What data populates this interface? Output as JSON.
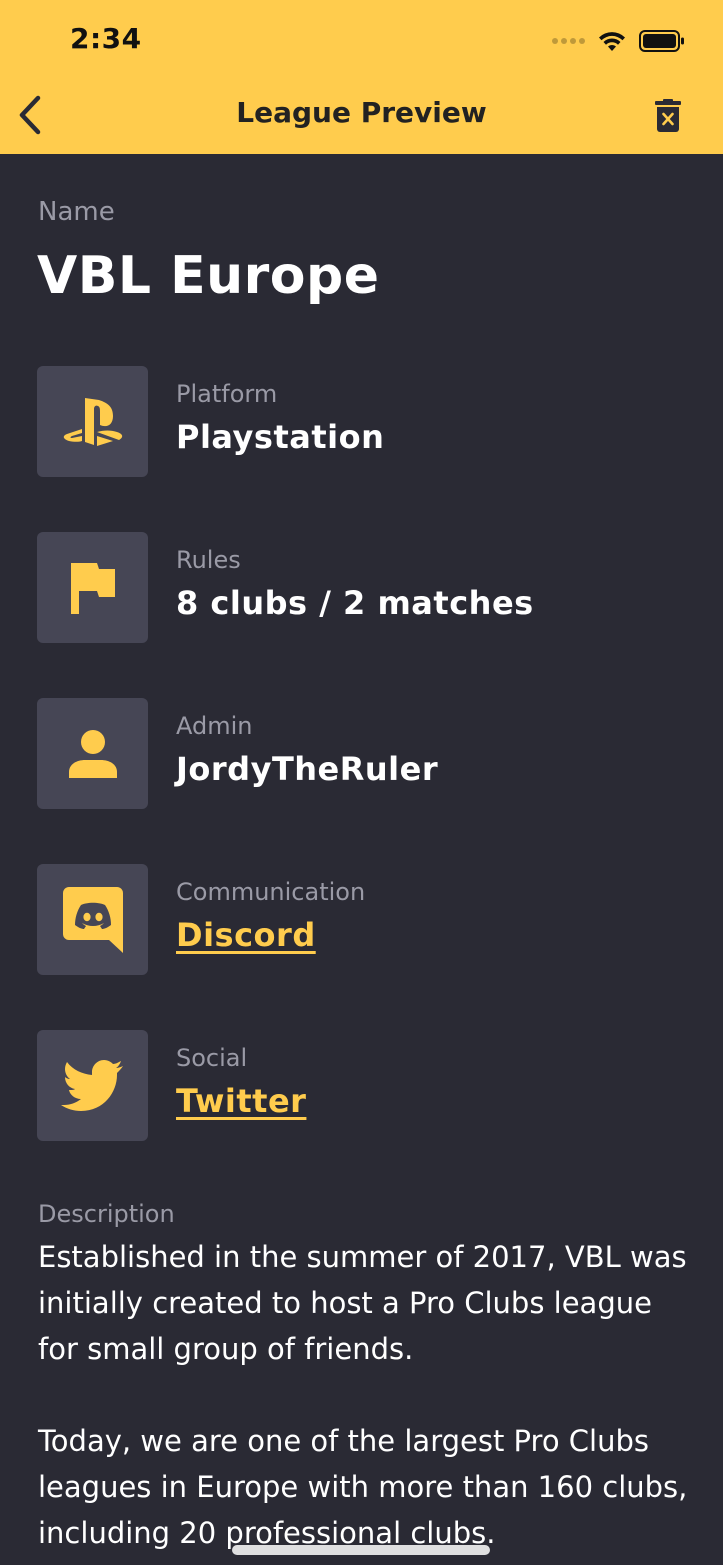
{
  "status_bar": {
    "time": "2:34"
  },
  "nav": {
    "title": "League Preview",
    "back_icon": "chevron-left-icon",
    "delete_icon": "trash-icon"
  },
  "name": {
    "label": "Name",
    "value": "VBL Europe"
  },
  "details": [
    {
      "label": "Platform",
      "value": "Playstation",
      "icon": "playstation-icon",
      "link": false
    },
    {
      "label": "Rules",
      "value": "8 clubs / 2 matches",
      "icon": "flag-icon",
      "link": false
    },
    {
      "label": "Admin",
      "value": "JordyTheRuler",
      "icon": "person-icon",
      "link": false
    },
    {
      "label": "Communication",
      "value": "Discord",
      "icon": "discord-icon",
      "link": true
    },
    {
      "label": "Social",
      "value": "Twitter",
      "icon": "twitter-icon",
      "link": true
    }
  ],
  "description": {
    "label": "Description",
    "text": "Established in the summer of 2017, VBL was initially created to host a Pro Clubs league for small group of friends.\n\nToday, we are one of the largest Pro Clubs leagues in Europe with more than 160 clubs, including 20 professional clubs."
  },
  "colors": {
    "accent": "#ffcc4d",
    "background": "#2a2a34",
    "tile": "#464655",
    "muted_text": "#9a9aa6"
  }
}
